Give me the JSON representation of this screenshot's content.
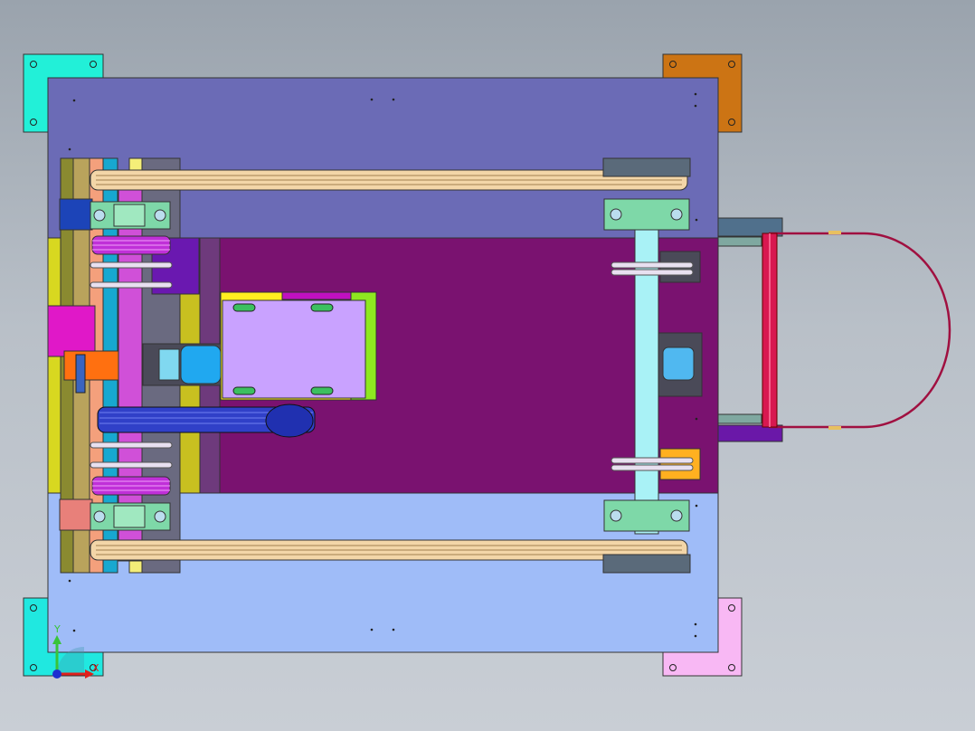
{
  "viewport": {
    "background_top": "#9aa3ad",
    "background_bottom": "#c9ced5"
  },
  "triad": {
    "y_label": "Y",
    "x_label": "X",
    "y_color": "#39c43a",
    "x_color": "#e0201c",
    "z_color": "#1e2fd0"
  },
  "colors": {
    "top_plate": "#6b6bb6",
    "bottom_plate": "#9fbcf8",
    "center_plate": "#7a1270",
    "corner_top_left": "#22f0d8",
    "corner_top_right": "#cc7414",
    "corner_bottom_left": "#20e8e0",
    "corner_bottom_right": "#f8b8f4",
    "belt": "#f3d6a8",
    "shaft": "#a9f2f6",
    "motor_box": "#c9a2ff",
    "gear_magenta": "#c030d8",
    "blue_belt": "#3040c8",
    "handle": "#d81850"
  }
}
